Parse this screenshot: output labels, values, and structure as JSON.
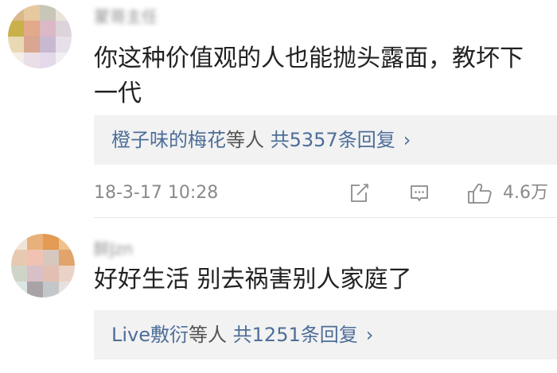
{
  "comments": [
    {
      "username": "蒙哥主任",
      "text": "你这种价值观的人也能抛头露面，教坏下一代",
      "reply_summary": {
        "users": "橙子味的梅花",
        "suffix": "等人",
        "count_text": "共5357条回复",
        "chevron": "›"
      },
      "timestamp": "18-3-17 10:28",
      "like_count": "4.6万",
      "icons": [
        "edit-icon",
        "comment-icon",
        "thumbs-up-icon"
      ]
    },
    {
      "username": "醉Jzn",
      "text": "好好生活 别去祸害别人家庭了",
      "reply_summary": {
        "users": "Live敷衍",
        "suffix": "等人",
        "count_text": "共1251条回复",
        "chevron": "›"
      }
    }
  ],
  "colors": {
    "link": "#4d6e99",
    "text": "#222222",
    "meta": "#8a8a8a",
    "reply_bg": "#f2f2f2"
  }
}
